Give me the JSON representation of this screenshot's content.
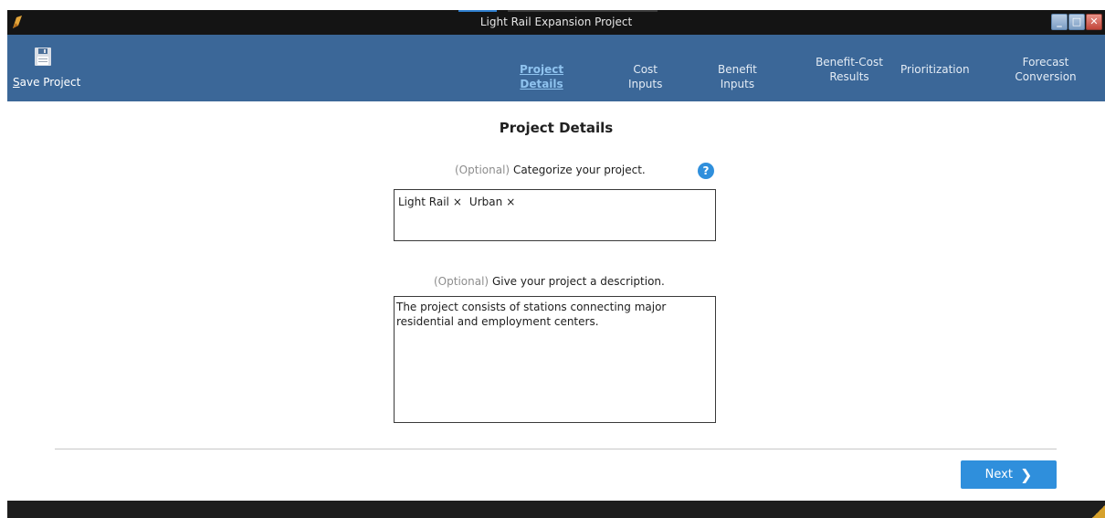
{
  "window": {
    "title": "Light Rail Expansion Project",
    "controls": {
      "minimize": "_",
      "maximize": "□",
      "close": "✕"
    }
  },
  "ribbon": {
    "save_button": {
      "mnemonic": "S",
      "rest": "ave Project",
      "icon": "floppy-disk-icon"
    },
    "nav": [
      {
        "label": "Project Details",
        "active": true
      },
      {
        "label": "Cost Inputs",
        "active": false
      },
      {
        "label": "Benefit Inputs",
        "active": false
      },
      {
        "label_line1": "Benefit-Cost",
        "label_line2": "Results",
        "active": false
      },
      {
        "label": "Prioritization",
        "active": false
      },
      {
        "label_line1": "Forecast",
        "label_line2": "Conversion",
        "active": false
      }
    ]
  },
  "main": {
    "title": "Project Details",
    "categorize": {
      "optional": "(Optional)",
      "prompt": "Categorize your project.",
      "help": "?",
      "tags": [
        {
          "label": "Light Rail",
          "remove": "×"
        },
        {
          "label": "Urban",
          "remove": "×"
        }
      ]
    },
    "description": {
      "optional": "(Optional)",
      "prompt": "Give your project a description.",
      "value": "The project consists of stations connecting major\nresidential and employment centers."
    },
    "next_button": {
      "label": "Next",
      "chevron": "❯"
    }
  },
  "colors": {
    "ribbon": "#3b6798",
    "titlebar": "#141414",
    "accent": "#2f8fdc",
    "active_nav": "#8fc3ef"
  }
}
